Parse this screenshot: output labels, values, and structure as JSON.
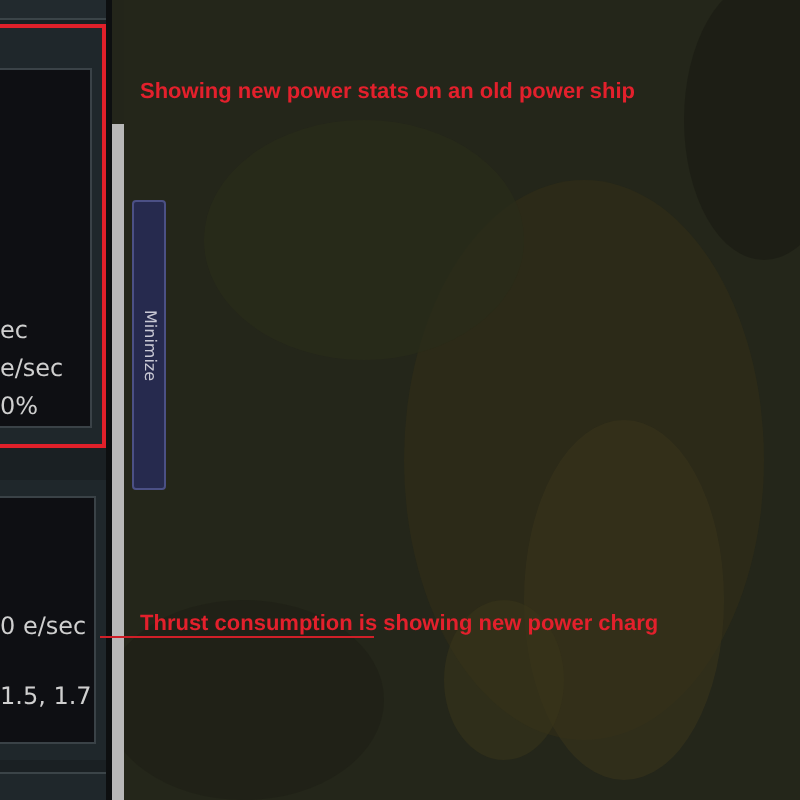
{
  "stats_panel": {
    "highlighted": true,
    "lines": [
      "ec",
      "e/sec",
      "0%"
    ]
  },
  "thrust_panel": {
    "highlighted": false,
    "lines": [
      "0 e/sec",
      "1.5, 1.7"
    ]
  },
  "minimize_button": {
    "label": "Minimize"
  },
  "annotations": [
    {
      "text": "Showing new power stats on an old power ship",
      "leader_line": false
    },
    {
      "text": "Thrust consumption is showing new power charg",
      "leader_line": true
    }
  ]
}
